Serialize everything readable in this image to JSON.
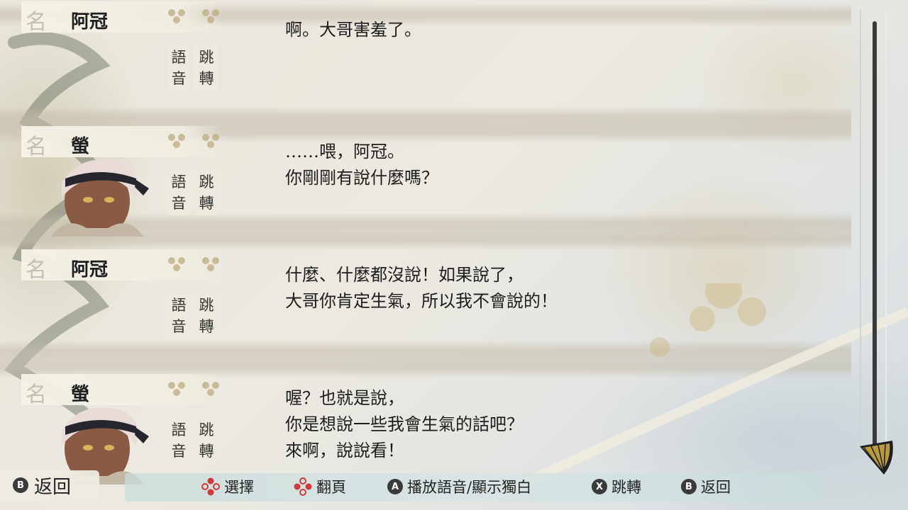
{
  "entries": [
    {
      "speaker": "阿冠",
      "name_mark": "名",
      "has_portrait": false,
      "voice_label": [
        "語",
        "音"
      ],
      "jump_label": [
        "跳",
        "轉"
      ],
      "text": "啊。大哥害羞了。"
    },
    {
      "speaker": "螢",
      "name_mark": "名",
      "has_portrait": true,
      "voice_label": [
        "語",
        "音"
      ],
      "jump_label": [
        "跳",
        "轉"
      ],
      "text": "……喂，阿冠。\n你剛剛有說什麼嗎？"
    },
    {
      "speaker": "阿冠",
      "name_mark": "名",
      "has_portrait": false,
      "voice_label": [
        "語",
        "音"
      ],
      "jump_label": [
        "跳",
        "轉"
      ],
      "text": "什麼、什麼都沒說！如果說了，\n大哥你肯定生氣，所以我不會說的！"
    },
    {
      "speaker": "螢",
      "name_mark": "名",
      "has_portrait": true,
      "voice_label": [
        "語",
        "音"
      ],
      "jump_label": [
        "跳",
        "轉"
      ],
      "text": "喔？也就是說，\n你是想說一些我會生氣的話吧？\n來啊，說說看！"
    }
  ],
  "back": {
    "badge": "B",
    "label": "返回"
  },
  "guides": [
    {
      "icon": "dpad-vertical-icon",
      "label": "選擇"
    },
    {
      "icon": "dpad-horizontal-icon",
      "label": "翻頁"
    },
    {
      "badge": "A",
      "label": "播放語音/顯示獨白"
    },
    {
      "badge": "X",
      "label": "跳轉"
    },
    {
      "badge": "B",
      "label": "返回"
    }
  ],
  "colors": {
    "dpad_red": "#d23a3a",
    "badge_dark": "#3a3a3a",
    "text": "#1c1c1c"
  }
}
